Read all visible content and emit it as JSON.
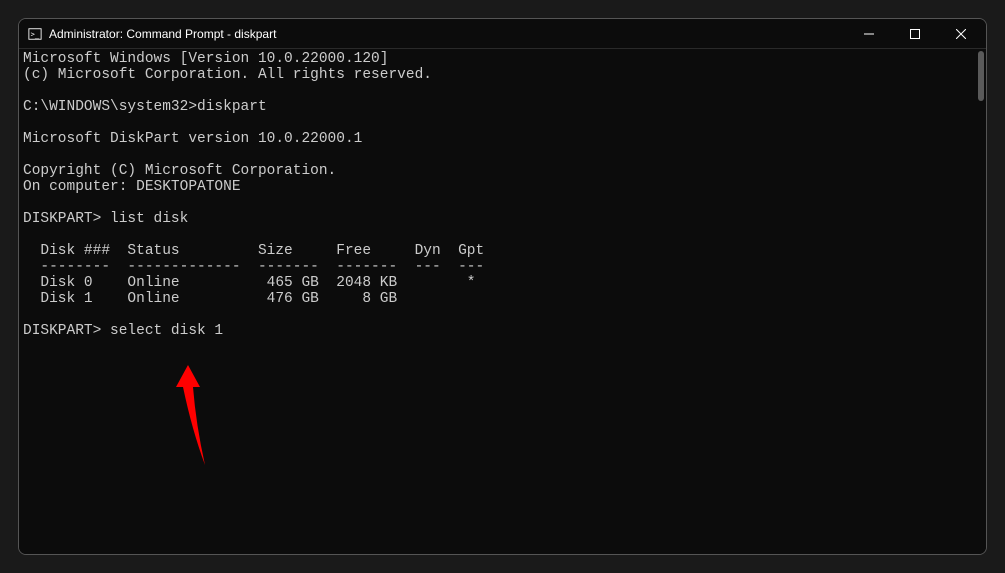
{
  "window": {
    "title": "Administrator: Command Prompt - diskpart"
  },
  "terminal": {
    "line1": "Microsoft Windows [Version 10.0.22000.120]",
    "line2": "(c) Microsoft Corporation. All rights reserved.",
    "blank1": "",
    "line3": "C:\\WINDOWS\\system32>diskpart",
    "blank2": "",
    "line4": "Microsoft DiskPart version 10.0.22000.1",
    "blank3": "",
    "line5": "Copyright (C) Microsoft Corporation.",
    "line6": "On computer: DESKTOPATONE",
    "blank4": "",
    "line7": "DISKPART> list disk",
    "blank5": "",
    "table_header": "  Disk ###  Status         Size     Free     Dyn  Gpt",
    "table_divider": "  --------  -------------  -------  -------  ---  ---",
    "table_row0": "  Disk 0    Online          465 GB  2048 KB        *",
    "table_row1": "  Disk 1    Online          476 GB     8 GB",
    "blank6": "",
    "line8": "DISKPART> select disk 1"
  }
}
